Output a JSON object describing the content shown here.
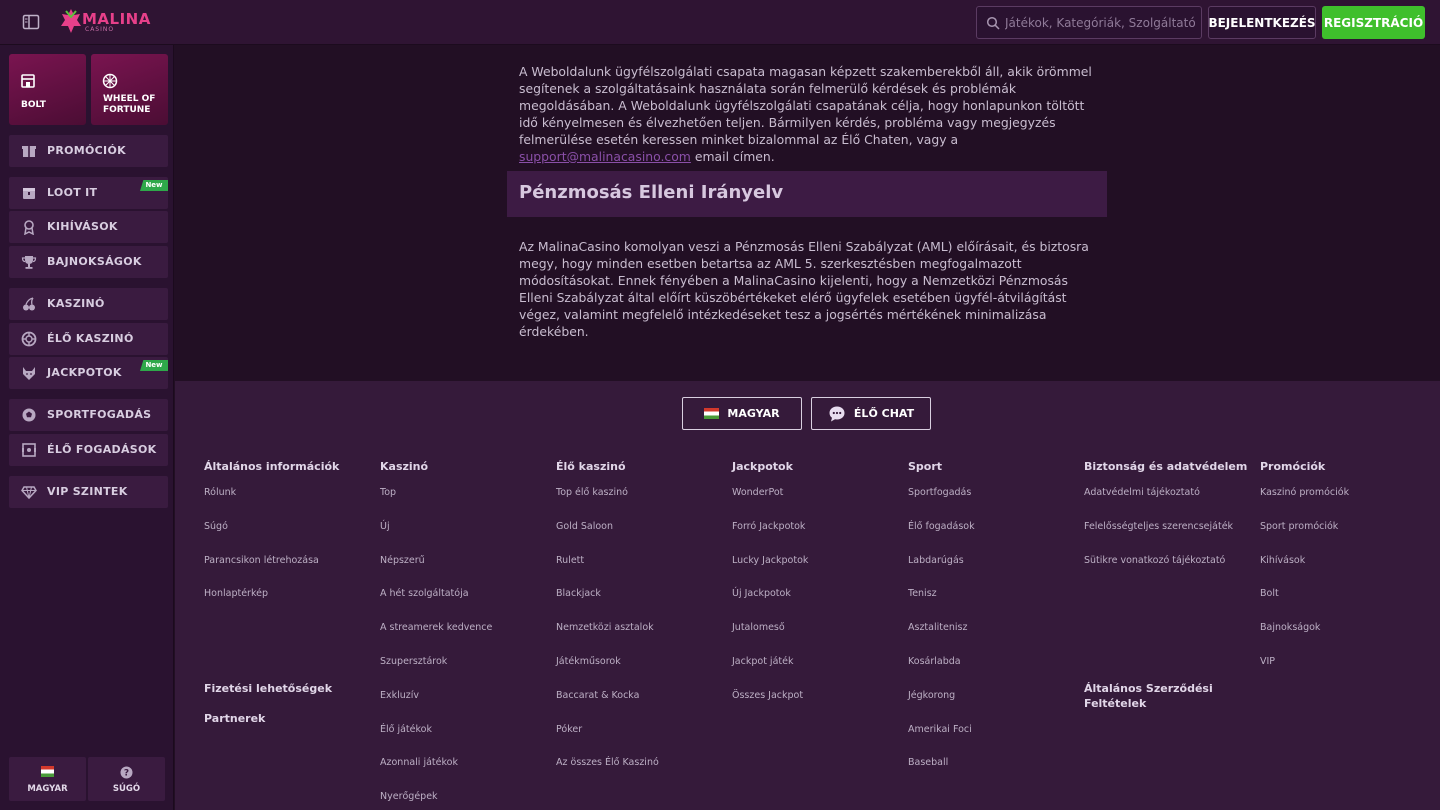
{
  "header": {
    "logo_text": "MALINA",
    "logo_sub": "CASINO",
    "search_placeholder": "Játékok, Kategóriák, Szolgáltatók",
    "login_label": "BEJELENTKEZÉS",
    "register_label": "REGISZTRÁCIÓ",
    "colors": {
      "register": "#3fbf2c",
      "brand": "#e7408a"
    }
  },
  "sidebar": {
    "tiles": [
      {
        "label": "BOLT",
        "icon": "shop-icon"
      },
      {
        "label": "WHEEL OF FORTUNE",
        "icon": "wheel-icon"
      }
    ],
    "items": [
      {
        "label": "PROMÓCIÓK",
        "icon": "gift-icon",
        "badge": ""
      },
      {
        "label": "LOOT IT",
        "icon": "loot-icon",
        "badge": "New"
      },
      {
        "label": "KIHÍVÁSOK",
        "icon": "medal-icon",
        "badge": ""
      },
      {
        "label": "BAJNOKSÁGOK",
        "icon": "trophy-icon",
        "badge": ""
      },
      {
        "label": "KASZINÓ",
        "icon": "cherry-icon",
        "badge": ""
      },
      {
        "label": "ÉLŐ KASZINÓ",
        "icon": "chip-icon",
        "badge": ""
      },
      {
        "label": "JACKPOTOK",
        "icon": "wolf-icon",
        "badge": "New"
      },
      {
        "label": "SPORTFOGADÁS",
        "icon": "football-icon",
        "badge": ""
      },
      {
        "label": "ÉLŐ FOGADÁSOK",
        "icon": "live-bet-icon",
        "badge": ""
      },
      {
        "label": "VIP SZINTEK",
        "icon": "diamond-icon",
        "badge": ""
      }
    ],
    "bottom": [
      {
        "label": "MAGYAR",
        "icon": "hungary-flag-icon"
      },
      {
        "label": "SÚGÓ",
        "icon": "help-icon"
      }
    ]
  },
  "main": {
    "intro_text": "A Weboldalunk ügyfélszolgálati csapata magasan képzett szakemberekből áll, akik örömmel segítenek a szolgáltatásaink használata során felmerülő kérdések és problémák megoldásában. A Weboldalunk ügyfélszolgálati csapatának célja, hogy honlapunkon töltött idő kényelmesen és élvezhetően teljen. Bármilyen kérdés, probléma vagy megjegyzés felmerülése esetén keressen minket bizalommal az Élő Chaten, vagy a",
    "support_email": "support@malinacasino.com",
    "intro_suffix": "email címen.",
    "section_title": "Pénzmosás Elleni Irányelv",
    "section_text": "Az MalinaCasino komolyan veszi a Pénzmosás Elleni Szabályzat (AML) előírásait, és biztosra megy, hogy minden esetben betartsa az AML 5. szerkesztésben megfogalmazott módosításokat. Ennek fényében a MalinaCasino kijelenti, hogy a Nemzetközi Pénzmosás Elleni Szabályzat által előírt küszöbértékeket elérő ügyfelek esetében ügyfél-átvilágítást végez, valamint megfelelő intézkedéseket tesz a jogsértés mértékének minimalizása érdekében."
  },
  "footer": {
    "language_button": "MAGYAR",
    "chat_button": "ÉLŐ CHAT",
    "columns": [
      {
        "title": "Általános információk",
        "links": [
          "Rólunk",
          "Súgó",
          "Parancsikon létrehozása",
          "Honlaptérkép"
        ]
      },
      {
        "title": "Kaszinó",
        "links": [
          "Top",
          "Új",
          "Népszerű",
          "A hét szolgáltatója",
          "A streamerek kedvence",
          "Szupersztárok",
          "Exkluzív",
          "Élő játékok",
          "Azonnali játékok",
          "Nyerőgépek"
        ]
      },
      {
        "title": "Élő kaszinó",
        "links": [
          "Top élő kaszinó",
          "Gold Saloon",
          "Rulett",
          "Blackjack",
          "Nemzetközi asztalok",
          "Játékműsorok",
          "Baccarat & Kocka",
          "Póker",
          "Az összes Élő Kaszinó"
        ]
      },
      {
        "title": "Jackpotok",
        "links": [
          "WonderPot",
          "Forró Jackpotok",
          "Lucky Jackpotok",
          "Új Jackpotok",
          "Jutalomeső",
          "Jackpot játék",
          "Összes Jackpot"
        ]
      },
      {
        "title": "Sport",
        "links": [
          "Sportfogadás",
          "Élő fogadások",
          "Labdarúgás",
          "Tenisz",
          "Asztalitenisz",
          "Kosárlabda",
          "Jégkorong",
          "Amerikai Foci",
          "Baseball"
        ]
      },
      {
        "title": "Biztonság és adatvédelem",
        "links": [
          "Adatvédelmi tájékoztató",
          "Felelősségteljes szerencsejáték",
          "Sütikre vonatkozó tájékoztató"
        ]
      },
      {
        "title": "Promóciók",
        "links": [
          "Kaszinó promóciók",
          "Sport promóciók",
          "Kihívások",
          "Bolt",
          "Bajnokságok",
          "VIP"
        ]
      }
    ],
    "extra_heads": [
      "Fizetési lehetőségek",
      "Partnerek",
      "Általános Szerződési Feltételek"
    ]
  }
}
